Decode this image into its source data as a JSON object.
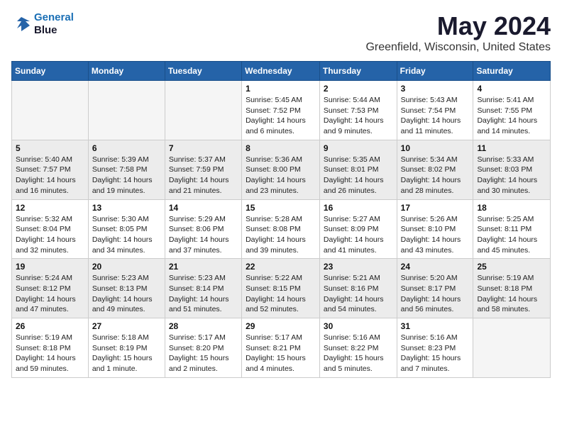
{
  "logo": {
    "line1": "General",
    "line2": "Blue"
  },
  "title": "May 2024",
  "location": "Greenfield, Wisconsin, United States",
  "days_of_week": [
    "Sunday",
    "Monday",
    "Tuesday",
    "Wednesday",
    "Thursday",
    "Friday",
    "Saturday"
  ],
  "weeks": [
    [
      {
        "day": "",
        "info": ""
      },
      {
        "day": "",
        "info": ""
      },
      {
        "day": "",
        "info": ""
      },
      {
        "day": "1",
        "info": "Sunrise: 5:45 AM\nSunset: 7:52 PM\nDaylight: 14 hours\nand 6 minutes."
      },
      {
        "day": "2",
        "info": "Sunrise: 5:44 AM\nSunset: 7:53 PM\nDaylight: 14 hours\nand 9 minutes."
      },
      {
        "day": "3",
        "info": "Sunrise: 5:43 AM\nSunset: 7:54 PM\nDaylight: 14 hours\nand 11 minutes."
      },
      {
        "day": "4",
        "info": "Sunrise: 5:41 AM\nSunset: 7:55 PM\nDaylight: 14 hours\nand 14 minutes."
      }
    ],
    [
      {
        "day": "5",
        "info": "Sunrise: 5:40 AM\nSunset: 7:57 PM\nDaylight: 14 hours\nand 16 minutes."
      },
      {
        "day": "6",
        "info": "Sunrise: 5:39 AM\nSunset: 7:58 PM\nDaylight: 14 hours\nand 19 minutes."
      },
      {
        "day": "7",
        "info": "Sunrise: 5:37 AM\nSunset: 7:59 PM\nDaylight: 14 hours\nand 21 minutes."
      },
      {
        "day": "8",
        "info": "Sunrise: 5:36 AM\nSunset: 8:00 PM\nDaylight: 14 hours\nand 23 minutes."
      },
      {
        "day": "9",
        "info": "Sunrise: 5:35 AM\nSunset: 8:01 PM\nDaylight: 14 hours\nand 26 minutes."
      },
      {
        "day": "10",
        "info": "Sunrise: 5:34 AM\nSunset: 8:02 PM\nDaylight: 14 hours\nand 28 minutes."
      },
      {
        "day": "11",
        "info": "Sunrise: 5:33 AM\nSunset: 8:03 PM\nDaylight: 14 hours\nand 30 minutes."
      }
    ],
    [
      {
        "day": "12",
        "info": "Sunrise: 5:32 AM\nSunset: 8:04 PM\nDaylight: 14 hours\nand 32 minutes."
      },
      {
        "day": "13",
        "info": "Sunrise: 5:30 AM\nSunset: 8:05 PM\nDaylight: 14 hours\nand 34 minutes."
      },
      {
        "day": "14",
        "info": "Sunrise: 5:29 AM\nSunset: 8:06 PM\nDaylight: 14 hours\nand 37 minutes."
      },
      {
        "day": "15",
        "info": "Sunrise: 5:28 AM\nSunset: 8:08 PM\nDaylight: 14 hours\nand 39 minutes."
      },
      {
        "day": "16",
        "info": "Sunrise: 5:27 AM\nSunset: 8:09 PM\nDaylight: 14 hours\nand 41 minutes."
      },
      {
        "day": "17",
        "info": "Sunrise: 5:26 AM\nSunset: 8:10 PM\nDaylight: 14 hours\nand 43 minutes."
      },
      {
        "day": "18",
        "info": "Sunrise: 5:25 AM\nSunset: 8:11 PM\nDaylight: 14 hours\nand 45 minutes."
      }
    ],
    [
      {
        "day": "19",
        "info": "Sunrise: 5:24 AM\nSunset: 8:12 PM\nDaylight: 14 hours\nand 47 minutes."
      },
      {
        "day": "20",
        "info": "Sunrise: 5:23 AM\nSunset: 8:13 PM\nDaylight: 14 hours\nand 49 minutes."
      },
      {
        "day": "21",
        "info": "Sunrise: 5:23 AM\nSunset: 8:14 PM\nDaylight: 14 hours\nand 51 minutes."
      },
      {
        "day": "22",
        "info": "Sunrise: 5:22 AM\nSunset: 8:15 PM\nDaylight: 14 hours\nand 52 minutes."
      },
      {
        "day": "23",
        "info": "Sunrise: 5:21 AM\nSunset: 8:16 PM\nDaylight: 14 hours\nand 54 minutes."
      },
      {
        "day": "24",
        "info": "Sunrise: 5:20 AM\nSunset: 8:17 PM\nDaylight: 14 hours\nand 56 minutes."
      },
      {
        "day": "25",
        "info": "Sunrise: 5:19 AM\nSunset: 8:18 PM\nDaylight: 14 hours\nand 58 minutes."
      }
    ],
    [
      {
        "day": "26",
        "info": "Sunrise: 5:19 AM\nSunset: 8:18 PM\nDaylight: 14 hours\nand 59 minutes."
      },
      {
        "day": "27",
        "info": "Sunrise: 5:18 AM\nSunset: 8:19 PM\nDaylight: 15 hours\nand 1 minute."
      },
      {
        "day": "28",
        "info": "Sunrise: 5:17 AM\nSunset: 8:20 PM\nDaylight: 15 hours\nand 2 minutes."
      },
      {
        "day": "29",
        "info": "Sunrise: 5:17 AM\nSunset: 8:21 PM\nDaylight: 15 hours\nand 4 minutes."
      },
      {
        "day": "30",
        "info": "Sunrise: 5:16 AM\nSunset: 8:22 PM\nDaylight: 15 hours\nand 5 minutes."
      },
      {
        "day": "31",
        "info": "Sunrise: 5:16 AM\nSunset: 8:23 PM\nDaylight: 15 hours\nand 7 minutes."
      },
      {
        "day": "",
        "info": ""
      }
    ]
  ]
}
